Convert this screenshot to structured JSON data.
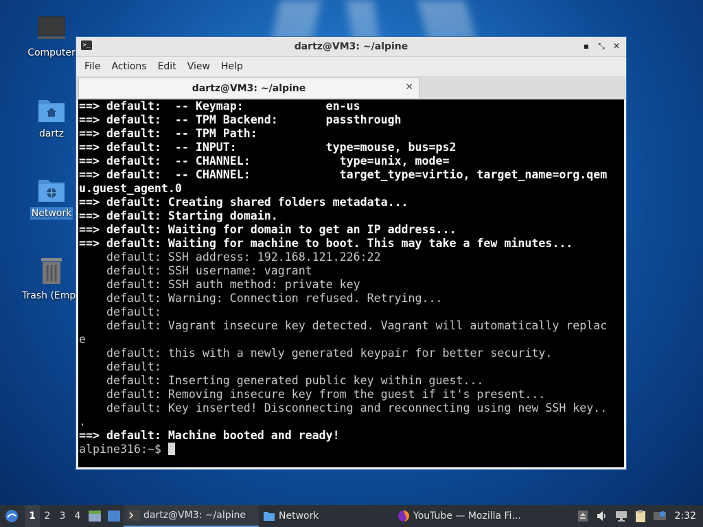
{
  "desktop": {
    "icons": [
      {
        "label": "Computer"
      },
      {
        "label": "dartz"
      },
      {
        "label": "Network"
      },
      {
        "label": "Trash (Empty)"
      }
    ]
  },
  "window": {
    "title": "dartz@VM3: ~/alpine",
    "menu": [
      "File",
      "Edit",
      "View",
      "Help"
    ],
    "menu_actions": "Actions",
    "tab": {
      "label": "dartz@VM3: ~/alpine"
    }
  },
  "terminal": {
    "lines": [
      {
        "text": "==> default:  -- Keymap:            en-us",
        "bold": true
      },
      {
        "text": "==> default:  -- TPM Backend:       passthrough",
        "bold": true
      },
      {
        "text": "==> default:  -- TPM Path:",
        "bold": true
      },
      {
        "text": "==> default:  -- INPUT:             type=mouse, bus=ps2",
        "bold": true
      },
      {
        "text": "==> default:  -- CHANNEL:             type=unix, mode=",
        "bold": true
      },
      {
        "text": "==> default:  -- CHANNEL:             target_type=virtio, target_name=org.qem",
        "bold": true
      },
      {
        "text": "u.guest_agent.0",
        "bold": true
      },
      {
        "text": "==> default: Creating shared folders metadata...",
        "bold": true
      },
      {
        "text": "==> default: Starting domain.",
        "bold": true
      },
      {
        "text": "==> default: Waiting for domain to get an IP address...",
        "bold": true
      },
      {
        "text": "==> default: Waiting for machine to boot. This may take a few minutes...",
        "bold": true
      },
      {
        "text": "    default: SSH address: 192.168.121.226:22",
        "bold": false
      },
      {
        "text": "    default: SSH username: vagrant",
        "bold": false
      },
      {
        "text": "    default: SSH auth method: private key",
        "bold": false
      },
      {
        "text": "    default: Warning: Connection refused. Retrying...",
        "bold": false
      },
      {
        "text": "    default:",
        "bold": false
      },
      {
        "text": "    default: Vagrant insecure key detected. Vagrant will automatically replac",
        "bold": false
      },
      {
        "text": "e",
        "bold": false
      },
      {
        "text": "    default: this with a newly generated keypair for better security.",
        "bold": false
      },
      {
        "text": "    default:",
        "bold": false
      },
      {
        "text": "    default: Inserting generated public key within guest...",
        "bold": false
      },
      {
        "text": "    default: Removing insecure key from the guest if it's present...",
        "bold": false
      },
      {
        "text": "    default: Key inserted! Disconnecting and reconnecting using new SSH key..",
        "bold": false
      },
      {
        "text": ".",
        "bold": false
      },
      {
        "text": "==> default: Machine booted and ready!",
        "bold": true
      }
    ],
    "prompt": "alpine316:~$ "
  },
  "taskbar": {
    "workspaces": [
      "1",
      "2",
      "3",
      "4"
    ],
    "active_workspace": "1",
    "tasks": [
      {
        "label": "dartz@VM3: ~/alpine",
        "icon": "terminal-icon",
        "active": true
      },
      {
        "label": "Network",
        "icon": "folder-icon",
        "active": false
      },
      {
        "label": "YouTube — Mozilla Fi...",
        "icon": "firefox-icon",
        "active": false
      }
    ],
    "clock": "2:32"
  }
}
